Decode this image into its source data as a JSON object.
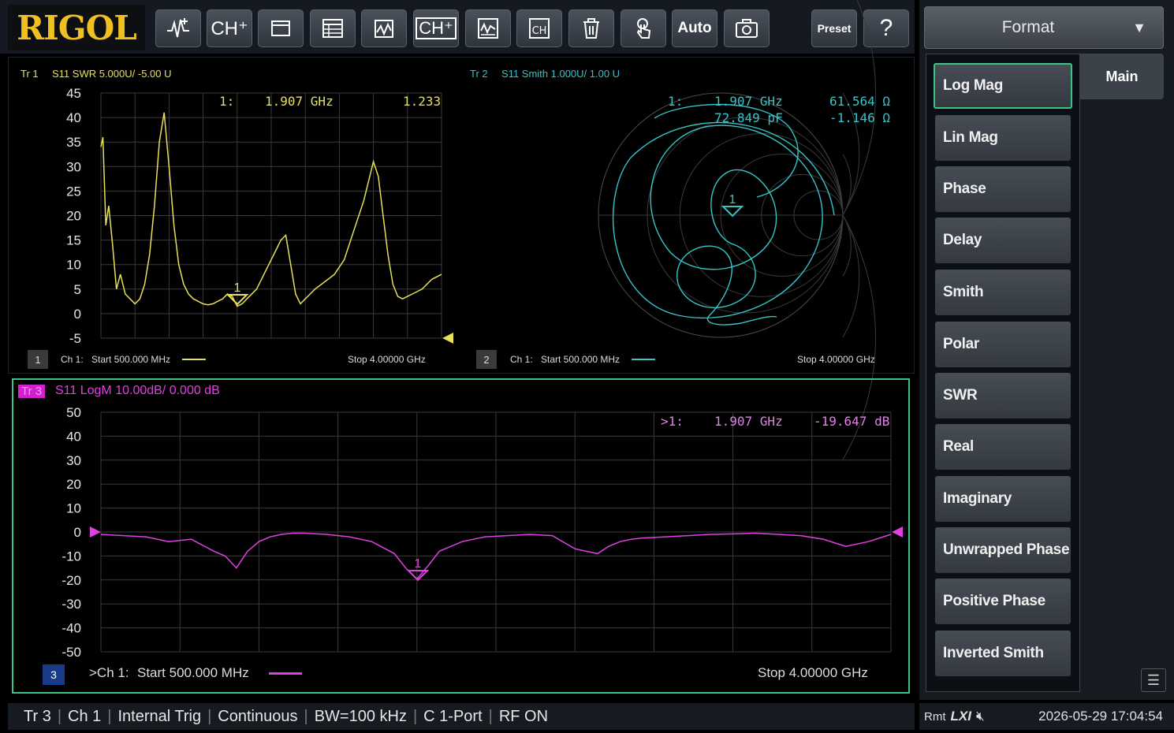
{
  "brand": {
    "logo": "RIGOL"
  },
  "toolbar": {
    "buttons": [
      {
        "label": "",
        "icon": "measure-icon"
      },
      {
        "label": "CH⁺",
        "icon": "add-channel-icon"
      },
      {
        "label": "",
        "icon": "window-icon"
      },
      {
        "label": "",
        "icon": "table-icon"
      },
      {
        "label": "",
        "icon": "trace-add-icon"
      },
      {
        "label": "CH⁺",
        "icon": "channel-window-icon"
      },
      {
        "label": "",
        "icon": "trace-list-icon"
      },
      {
        "label": "",
        "icon": "channel-config-icon"
      },
      {
        "label": "",
        "icon": "trash-icon"
      },
      {
        "label": "",
        "icon": "touch-icon"
      },
      {
        "label": "Auto",
        "icon": "auto-icon"
      },
      {
        "label": "",
        "icon": "camera-icon"
      },
      {
        "label": "Preset",
        "icon": "preset-icon"
      },
      {
        "label": "?",
        "icon": "help-icon"
      }
    ]
  },
  "format_menu": {
    "title": "Format",
    "tab": "Main",
    "items": [
      "Log Mag",
      "Lin Mag",
      "Phase",
      "Delay",
      "Smith",
      "Polar",
      "SWR",
      "Real",
      "Imaginary",
      "Unwrapped Phase",
      "Positive Phase",
      "Inverted Smith"
    ],
    "selected": "Log Mag"
  },
  "trace1": {
    "tag": "Tr 1",
    "header": "S11 SWR 5.000U/ -5.00 U",
    "marker_readout": {
      "id": "1:",
      "freq": "1.907 GHz",
      "value": "1.233"
    },
    "marker_label": "1",
    "channel_box": "1",
    "channel": "Ch 1:",
    "start": "Start  500.000 MHz",
    "stop": "Stop  4.00000 GHz",
    "color": "#e8e05a"
  },
  "trace2": {
    "tag": "Tr 2",
    "header": "S11 Smith 1.000U/ 1.00 U",
    "marker_readout": {
      "id": "1:",
      "freq": "1.907 GHz",
      "value1": "61.564 Ω",
      "value2": "72.849 pF",
      "value3": "-1.146 Ω"
    },
    "marker_label": "1",
    "channel_box": "2",
    "channel": "Ch 1:",
    "start": "Start  500.000 MHz",
    "stop": "Stop  4.00000 GHz",
    "color": "#36c4c8"
  },
  "trace3": {
    "tag": "Tr 3",
    "header": "S11 LogM 10.00dB/ 0.000 dB",
    "marker_readout": {
      "id": ">1:",
      "freq": "1.907 GHz",
      "value": "-19.647 dB"
    },
    "marker_label": "1",
    "channel_box": "3",
    "channel": ">Ch 1:",
    "start": "Start  500.000 MHz",
    "stop": "Stop  4.00000 GHz",
    "color": "#e040e0"
  },
  "chart_data": [
    {
      "type": "line",
      "name": "Tr 1",
      "ylim": [
        -5,
        45
      ],
      "yticks": [
        "45",
        "40",
        "35",
        "30",
        "25",
        "20",
        "15",
        "10",
        "5",
        "0",
        "-5"
      ],
      "x": [
        0.5,
        0.52,
        0.55,
        0.58,
        0.62,
        0.66,
        0.7,
        0.75,
        0.8,
        0.85,
        0.9,
        0.95,
        1.0,
        1.05,
        1.1,
        1.15,
        1.2,
        1.25,
        1.3,
        1.35,
        1.4,
        1.45,
        1.5,
        1.55,
        1.6,
        1.65,
        1.7,
        1.75,
        1.8,
        1.85,
        1.9,
        1.95,
        2.0,
        2.1,
        2.2,
        2.3,
        2.35,
        2.4,
        2.45,
        2.5,
        2.55,
        2.6,
        2.65,
        2.7,
        2.8,
        2.9,
        3.0,
        3.1,
        3.2,
        3.3,
        3.35,
        3.4,
        3.45,
        3.5,
        3.55,
        3.6,
        3.65,
        3.7,
        3.8,
        3.9,
        4.0
      ],
      "y": [
        34,
        36,
        18,
        22,
        14,
        5,
        8,
        4,
        3,
        2,
        3,
        6,
        12,
        22,
        35,
        41,
        30,
        18,
        10,
        6,
        4,
        3,
        2.5,
        2,
        1.8,
        2,
        2.5,
        3,
        4,
        3.5,
        1.5,
        2,
        3,
        5,
        9,
        13,
        15,
        16,
        10,
        4,
        2,
        3,
        4,
        5,
        6.5,
        8,
        11,
        17,
        23,
        31,
        28,
        20,
        12,
        6,
        3.5,
        3,
        3.5,
        4,
        5,
        7,
        8
      ]
    },
    {
      "type": "line",
      "name": "Tr 3",
      "ylim": [
        -50,
        50
      ],
      "yticks": [
        "50",
        "40",
        "30",
        "20",
        "10",
        "0",
        "-10",
        "-20",
        "-30",
        "-40",
        "-50"
      ],
      "x": [
        0.5,
        0.6,
        0.7,
        0.8,
        0.9,
        1.0,
        1.05,
        1.1,
        1.15,
        1.2,
        1.25,
        1.3,
        1.35,
        1.4,
        1.5,
        1.6,
        1.7,
        1.8,
        1.85,
        1.9,
        1.95,
        2.0,
        2.1,
        2.2,
        2.3,
        2.4,
        2.5,
        2.6,
        2.7,
        2.75,
        2.8,
        2.85,
        2.9,
        3.0,
        3.1,
        3.2,
        3.3,
        3.4,
        3.5,
        3.6,
        3.7,
        3.8,
        3.9,
        4.0
      ],
      "y": [
        -1,
        -1.5,
        -2,
        -4,
        -3,
        -8,
        -10,
        -15,
        -8,
        -4,
        -2,
        -1,
        -0.5,
        -0.5,
        -1,
        -2,
        -4,
        -9,
        -15,
        -19.6,
        -14,
        -8,
        -4,
        -2,
        -1.5,
        -1,
        -1.5,
        -7,
        -9,
        -6,
        -4,
        -3,
        -2.5,
        -2,
        -1.5,
        -1,
        -0.8,
        -0.5,
        -1,
        -1.5,
        -3,
        -6,
        -4,
        -1
      ]
    }
  ],
  "statusbar": {
    "items": [
      "Tr 3",
      "Ch 1",
      "Internal Trig",
      "Continuous",
      "BW=100 kHz",
      "C 1-Port",
      "RF ON"
    ],
    "remote": "Rmt",
    "lxi": "LXI",
    "mute_icon": "speaker-mute-icon",
    "datetime": "2026-05-29 17:04:54"
  }
}
